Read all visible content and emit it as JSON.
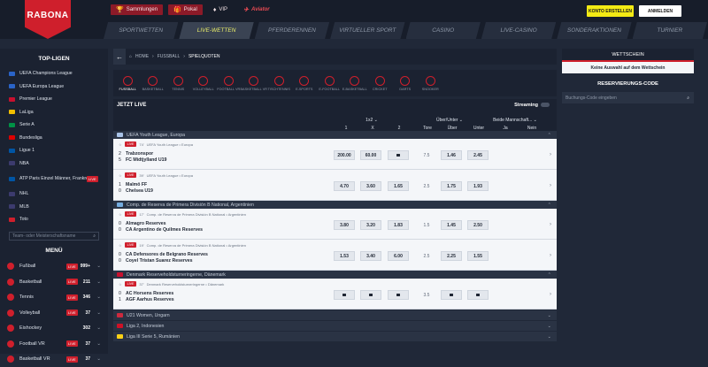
{
  "header": {
    "logo": "RABONA",
    "top_tabs": [
      {
        "label": "Sammlungen",
        "icon": "trophy-icon"
      },
      {
        "label": "Pokal",
        "icon": "gift-icon"
      },
      {
        "label": "VIP",
        "icon": "diamond-icon"
      },
      {
        "label": "Aviator",
        "icon": "plane-icon"
      }
    ],
    "register_label": "KONTO ERSTELLEN",
    "login_label": "ANMELDEN",
    "nav": [
      "SPORTWETTEN",
      "LIVE-WETTEN",
      "PFERDERENNEN",
      "VIRTUELLER SPORT",
      "CASINO",
      "LIVE-CASINO",
      "SONDERAKTIONEN",
      "TURNIER"
    ],
    "nav_active": 1
  },
  "sidebar": {
    "top_title": "TOP-LIGEN",
    "leagues": [
      {
        "label": "UEFA Champions League",
        "color": "#2a64c8"
      },
      {
        "label": "UEFA Europa League",
        "color": "#2a64c8"
      },
      {
        "label": "Premier League",
        "color": "#c8102e"
      },
      {
        "label": "LaLiga",
        "color": "#f1bf00"
      },
      {
        "label": "Serie A",
        "color": "#009246"
      },
      {
        "label": "Bundesliga",
        "color": "#dd0000"
      },
      {
        "label": "Ligue 1",
        "color": "#0055a4"
      },
      {
        "label": "NBA",
        "color": "#3c3b6e"
      },
      {
        "label": "ATP Paris Einzel Männer, Frankreich",
        "color": "#0055a4",
        "live": "LIVE"
      },
      {
        "label": "NHL",
        "color": "#3c3b6e"
      },
      {
        "label": "MLB",
        "color": "#3c3b6e"
      },
      {
        "label": "Toto",
        "color": "#cf1f2c"
      }
    ],
    "search_placeholder": "Team- oder Meisterschaftsname",
    "menu_title": "MENÜ",
    "menu": [
      {
        "label": "Fußball",
        "live": "LIVE",
        "count": "999+"
      },
      {
        "label": "Basketball",
        "live": "LIVE",
        "count": "211"
      },
      {
        "label": "Tennis",
        "live": "LIVE",
        "count": "346"
      },
      {
        "label": "Volleyball",
        "live": "LIVE",
        "count": "37"
      },
      {
        "label": "Eishockey",
        "live": "",
        "count": "302"
      },
      {
        "label": "Football VR",
        "live": "LIVE",
        "count": "37"
      },
      {
        "label": "Basketball VR",
        "live": "LIVE",
        "count": "37"
      }
    ]
  },
  "main": {
    "breadcrumb": [
      "HOME",
      "FUSSBALL",
      "SPIELQUOTEN"
    ],
    "sports": [
      "FUSSBALL",
      "BASKETBALL",
      "TENNIS",
      "VOLLEYBALL",
      "FOOTBALL VR",
      "BASKETBALL VR",
      "TISCHTENNIS",
      "E-SPORTS",
      "E-FOOTBALL",
      "E-BASKETBALL",
      "CRICKET",
      "DARTS",
      "SNOOKER"
    ],
    "live_title": "JETZT LIVE",
    "streaming_label": "Streaming",
    "col_groups": [
      "1x2",
      "Über/Unter",
      "Beide Mannschaft..."
    ],
    "cols": [
      "1",
      "X",
      "2",
      "Tore",
      "Über",
      "Unter",
      "Ja",
      "Nein"
    ],
    "leagues": [
      {
        "name": "UEFA Youth League, Europa",
        "flag": "#a8c2e6",
        "matches": [
          {
            "time": "74'",
            "comp": "UEFA Youth League • Europa",
            "home": "Trabzonspor",
            "away": "FC Midtjylland U19",
            "hs": "2",
            "as": "5",
            "o1": "200.00",
            "ox": "60.00",
            "o2": "",
            "tore": "7.5",
            "over": "1.46",
            "under": "2.45"
          },
          {
            "time": "39'",
            "comp": "UEFA Youth League • Europa",
            "home": "Malmö FF",
            "away": "Chelsea U19",
            "hs": "1",
            "as": "0",
            "o1": "4.70",
            "ox": "3.60",
            "o2": "1.65",
            "tore": "2.5",
            "over": "1.75",
            "under": "1.93"
          }
        ]
      },
      {
        "name": "Comp. de Reserva de Primera División B National, Argentinien",
        "flag": "#74acdf",
        "matches": [
          {
            "time": "17'",
            "comp": "Comp. de Reserva de Primera División B National • Argentinien",
            "home": "Almagro Reserves",
            "away": "CA Argentino de Quilmes Reserves",
            "hs": "0",
            "as": "0",
            "o1": "3.80",
            "ox": "3.20",
            "o2": "1.83",
            "tore": "1.5",
            "over": "1.45",
            "under": "2.50"
          },
          {
            "time": "19'",
            "comp": "Comp. de Reserva de Primera División B National • Argentinien",
            "home": "CA Defensores de Belgrano Reserves",
            "away": "Coyel Tristan Suarez Reserves",
            "hs": "0",
            "as": "0",
            "o1": "1.53",
            "ox": "3.40",
            "o2": "6.00",
            "tore": "2.5",
            "over": "2.25",
            "under": "1.55"
          }
        ]
      },
      {
        "name": "Denmark Reserveholdsturneringerne, Dänemark",
        "flag": "#c8102e",
        "matches": [
          {
            "time": "37'",
            "comp": "Denmark Reserveholdsturneringerne • Dänemark",
            "home": "AC Horsens Reserves",
            "away": "AGF Aarhus Reserves",
            "hs": "0",
            "as": "1",
            "o1": "",
            "ox": "",
            "o2": "",
            "tore": "3.5",
            "over": "",
            "under": ""
          }
        ]
      }
    ],
    "collapsed_leagues": [
      {
        "name": "U21 Women, Ungarn",
        "flag": "#cd2a3e"
      },
      {
        "name": "Liga 2, Indonesien",
        "flag": "#ce1126"
      },
      {
        "name": "Liga III Serie 5, Rumänien",
        "flag": "#fcd116"
      }
    ]
  },
  "right": {
    "wettschein_title": "WETTSCHEIN",
    "wettschein_empty": "Keine Auswahl auf dem Wettschein",
    "reserve_title": "RESERVIERUNGS-CODE",
    "reserve_placeholder": "Buchungs-Code eingeben"
  }
}
